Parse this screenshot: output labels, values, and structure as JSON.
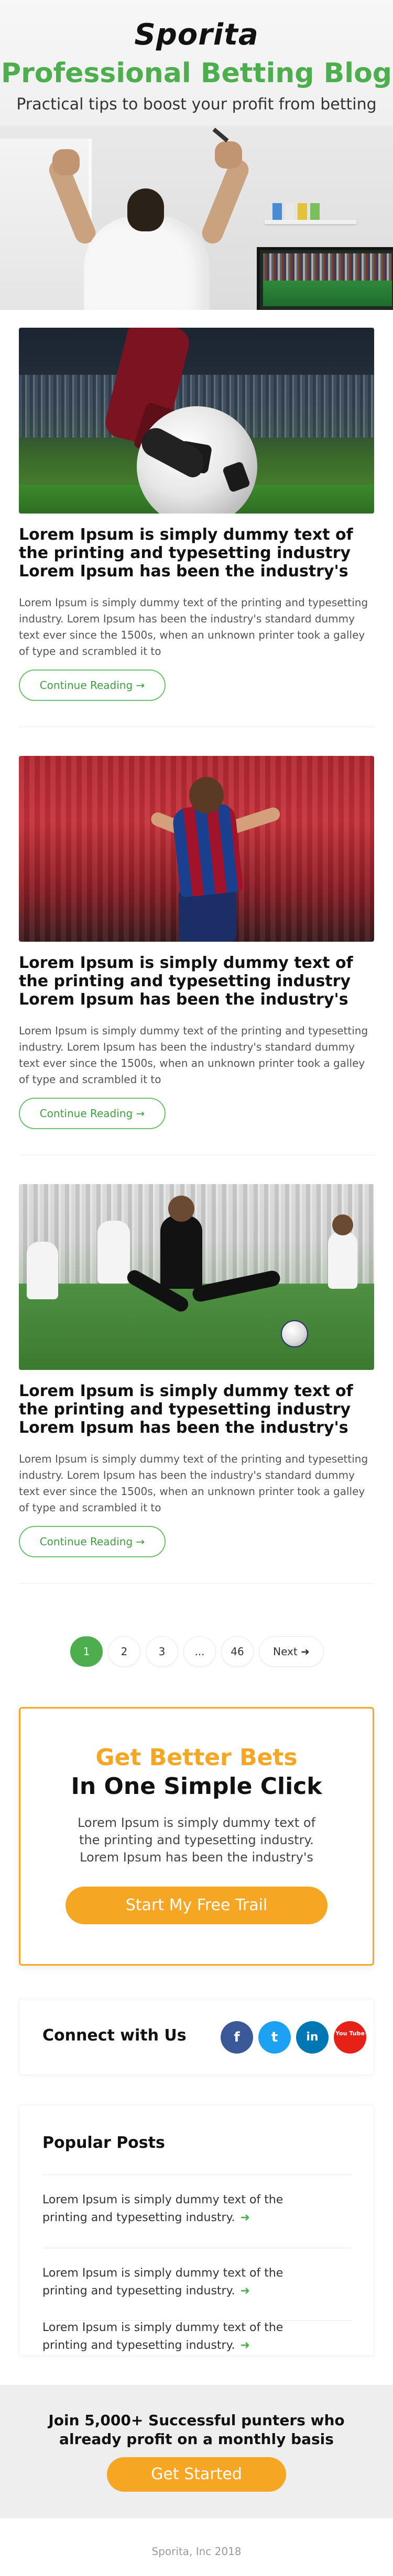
{
  "brand": {
    "logo_text": "Sporita"
  },
  "hero": {
    "title": "Professional Betting Blog",
    "subtitle": "Practical tips to boost your profit from betting"
  },
  "articles": [
    {
      "title": "Lorem Ipsum is simply dummy text of the printing and typesetting industry Lorem Ipsum has been the industry's",
      "excerpt": "Lorem Ipsum is simply dummy text of the printing and typesetting industry. Lorem Ipsum has been the industry's standard dummy text ever since the 1500s, when an unknown printer took a galley of type and scrambled it to",
      "button": "Continue Reading →"
    },
    {
      "title": "Lorem Ipsum is simply dummy text of the printing and typesetting industry Lorem Ipsum has been the industry's",
      "excerpt": "Lorem Ipsum is simply dummy text of the printing and typesetting industry. Lorem Ipsum has been the industry's standard dummy text ever since the 1500s, when an unknown printer took a galley of type and scrambled it to",
      "button": "Continue Reading →"
    },
    {
      "title": "Lorem Ipsum is simply dummy text of the printing and typesetting industry Lorem Ipsum has been the industry's",
      "excerpt": "Lorem Ipsum is simply dummy text of the printing and typesetting industry. Lorem Ipsum has been the industry's standard dummy text ever since the 1500s, when an unknown printer took a galley of type and scrambled it to",
      "button": "Continue Reading →"
    }
  ],
  "pagination": {
    "pages": [
      "1",
      "2",
      "3",
      "...",
      "46"
    ],
    "active": "1",
    "next": "Next ➜"
  },
  "cta": {
    "title_line1": "Get Better Bets",
    "title_line2": "In One Simple Click",
    "text": "Lorem Ipsum is simply dummy text of the printing and typesetting industry. Lorem Ipsum has been the industry's",
    "button": "Start My Free Trail"
  },
  "connect": {
    "label": "Connect with Us",
    "networks": [
      {
        "icon": "facebook-icon",
        "glyph": "f",
        "color": "#3b5998"
      },
      {
        "icon": "twitter-icon",
        "glyph": "t",
        "color": "#1da1f2"
      },
      {
        "icon": "linkedin-icon",
        "glyph": "in",
        "color": "#0077b5"
      },
      {
        "icon": "youtube-icon",
        "glyph": "You Tube",
        "color": "#e62117"
      }
    ]
  },
  "popular": {
    "title": "Popular Posts",
    "items": [
      {
        "text": "Lorem Ipsum is simply dummy text of the printing and typesetting industry.",
        "arrow": "➜"
      },
      {
        "text": "Lorem Ipsum is simply dummy text of the printing and typesetting industry.",
        "arrow": "➜"
      },
      {
        "text": "Lorem Ipsum is simply dummy text of the printing and typesetting industry.",
        "arrow": "➜"
      }
    ]
  },
  "footer": {
    "line1": "Join 5,000+ Successful punters who",
    "line2": "already profit on a monthly basis",
    "button": "Get Started",
    "copyright": "Sporita, Inc 2018"
  },
  "colors": {
    "accent_green": "#4cae4c",
    "accent_orange": "#f5a623"
  }
}
